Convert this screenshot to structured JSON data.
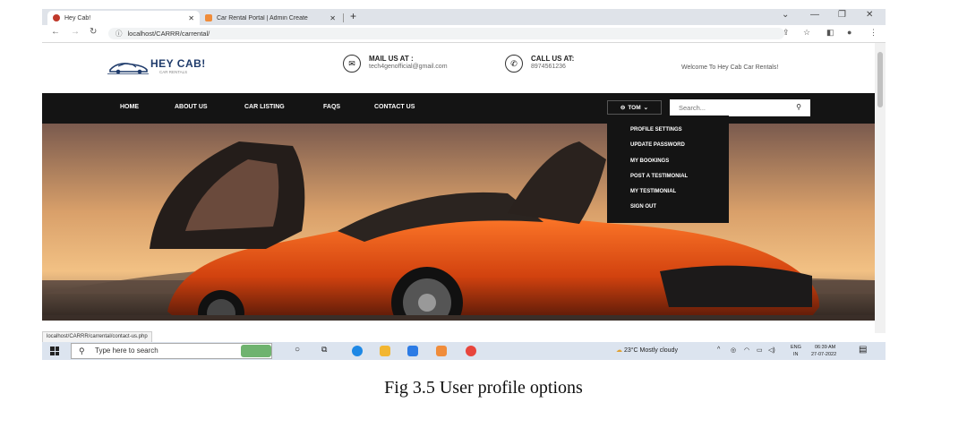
{
  "browser": {
    "tabs": [
      {
        "title": "Hey Cab!",
        "active": true
      },
      {
        "title": "Car Rental Portal | Admin Create",
        "active": false
      }
    ],
    "url": "localhost/CARRR/carrental/",
    "status_url": "localhost/CARRR/carrental/contact-us.php"
  },
  "site": {
    "logo_title": "HEY CAB!",
    "logo_sub": "CAR RENTALS",
    "mail_label": "MAIL US AT :",
    "mail_value": "tech4genofficial@gmail.com",
    "call_label": "CALL US AT:",
    "call_value": "8974561236",
    "welcome": "Welcome To Hey Cab Car Rentals!"
  },
  "nav": {
    "items": [
      "HOME",
      "ABOUT US",
      "CAR LISTING",
      "FAQS",
      "CONTACT US"
    ],
    "user_label": "TOM",
    "search_placeholder": "Search..."
  },
  "user_menu": {
    "items": [
      "PROFILE SETTINGS",
      "UPDATE PASSWORD",
      "MY BOOKINGS",
      "POST A TESTIMONIAL",
      "MY TESTIMONIAL",
      "SIGN OUT"
    ]
  },
  "taskbar": {
    "search_text": "Type here to search",
    "weather": "23°C  Mostly cloudy",
    "lang_top": "ENG",
    "lang_bottom": "IN",
    "time": "06:39 AM",
    "date": "27-07-2022"
  },
  "caption": "Fig 3.5 User profile options",
  "colors": {
    "navbar": "#141414",
    "logo": "#1f3b6b",
    "taskbar": "#dce4ef"
  }
}
